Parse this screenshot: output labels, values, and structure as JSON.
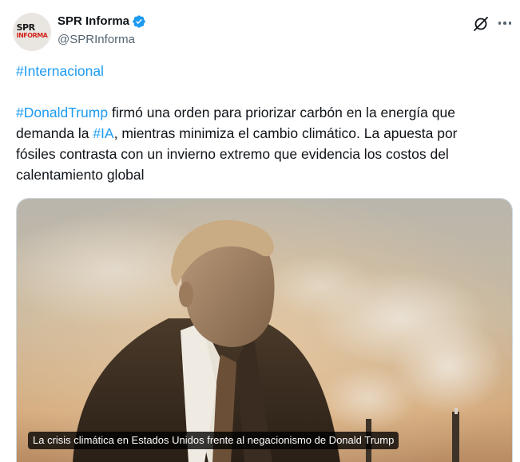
{
  "author": {
    "display_name": "SPR Informa",
    "handle": "@SPRInforma",
    "avatar_text_line1": "SPR",
    "avatar_text_line2": "INFORMA"
  },
  "post": {
    "hashtag_section": "#Internacional",
    "hashtag_trump": "#DonaldTrump",
    "text_l1": " firmó una orden para priorizar carbón en la energía que",
    "text_l2_a": "demanda la ",
    "hashtag_ia": "#IA",
    "text_l2_b": ", mientras minimiza el cambio climático. La apuesta por",
    "text_l3": "fósiles contrasta con un invierno extremo que evidencia los costos del",
    "text_l4": "calentamiento global"
  },
  "media": {
    "caption": "La crisis climática en Estados Unidos frente al negacionismo de Donald Trump"
  },
  "icons": {
    "verified": "verified-badge-icon",
    "grok": "grok-icon",
    "more": "more-options-icon"
  },
  "colors": {
    "link": "#1d9bf0",
    "verified": "#1d9bf0",
    "text": "#0f1419",
    "secondary": "#536471"
  }
}
